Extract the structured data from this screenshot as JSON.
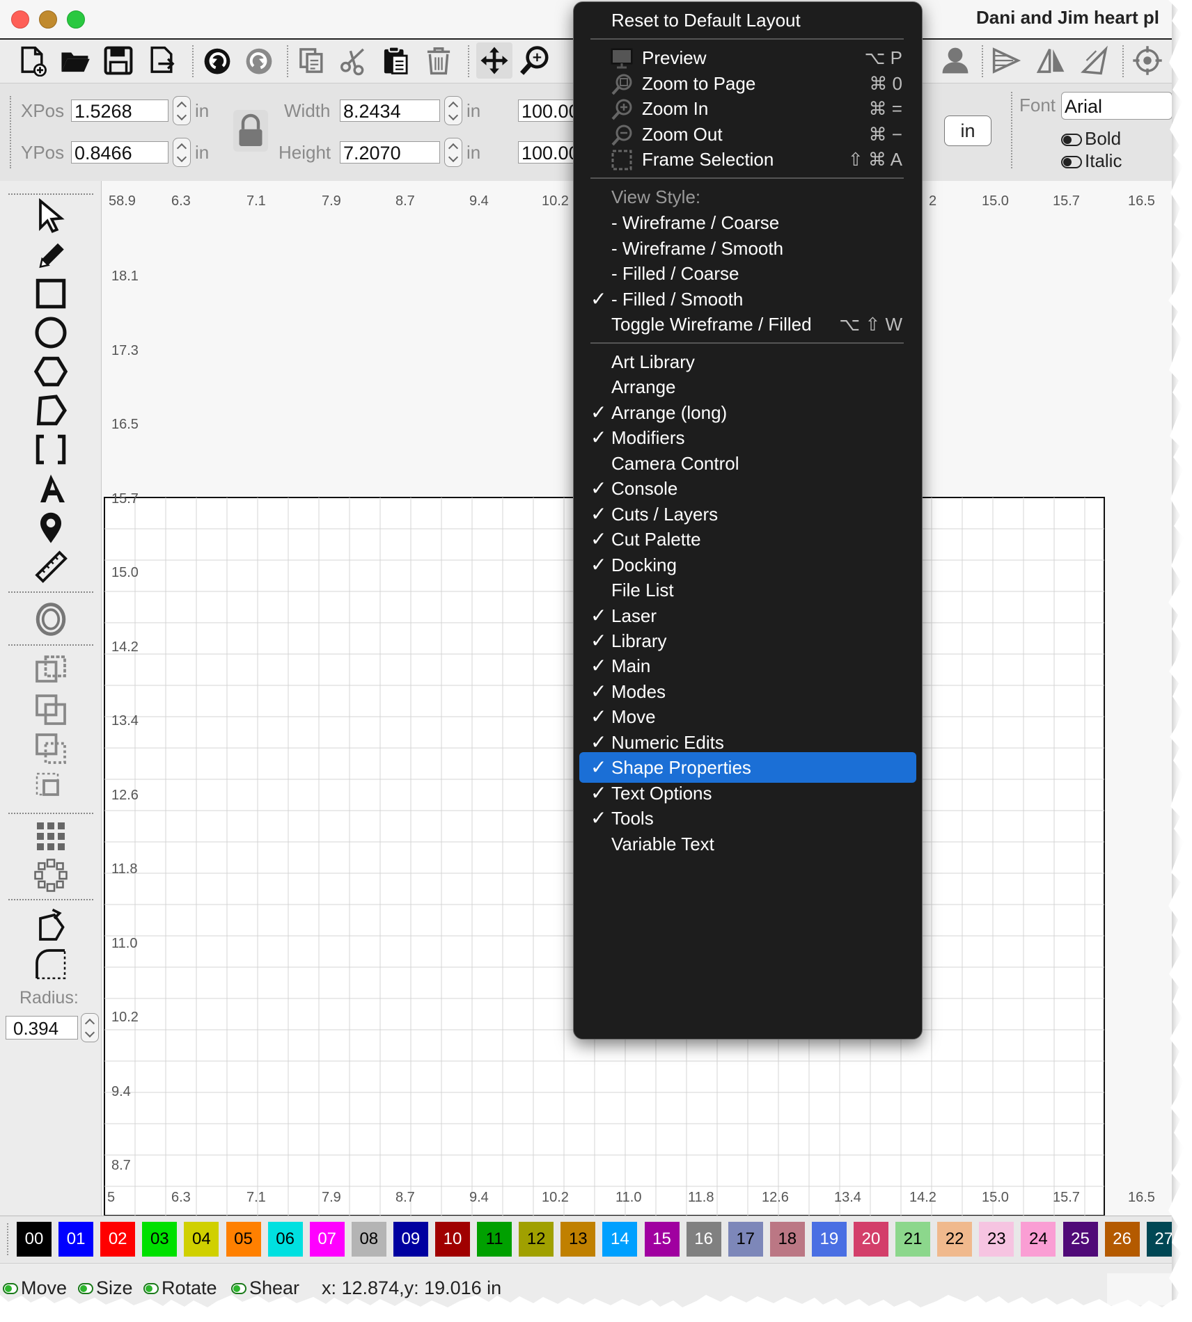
{
  "window": {
    "title": "Dani and Jim heart pl"
  },
  "toolbar": {
    "icons": [
      "new-file-icon",
      "open-folder-icon",
      "save-icon",
      "export-icon",
      "undo-icon",
      "redo-icon",
      "copy-icon",
      "cut-icon",
      "paste-icon",
      "delete-icon",
      "move-icon",
      "zoom-icon",
      "user-icon",
      "mirror-horizontal-icon",
      "mirror-icon",
      "mirror-vertical-icon",
      "target-icon"
    ]
  },
  "numeric": {
    "xpos_label": "XPos",
    "xpos_value": "1.5268",
    "ypos_label": "YPos",
    "ypos_value": "0.8466",
    "width_label": "Width",
    "width_value": "8.2434",
    "height_label": "Height",
    "height_value": "7.2070",
    "unit": "in",
    "pct_w": "100.00",
    "pct_h": "100.00",
    "unit_button": "in",
    "font_label": "Font",
    "font_value": "Arial",
    "bold_label": "Bold",
    "italic_label": "Italic"
  },
  "left_tools": {
    "radius_label": "Radius:",
    "radius_value": "0.394"
  },
  "ruler": {
    "top": [
      "58.9",
      "6.3",
      "7.1",
      "7.9",
      "8.7",
      "9.4",
      "10.2",
      "2",
      "15.0",
      "15.7",
      "16.5"
    ],
    "bottom": [
      "5",
      "6.3",
      "7.1",
      "7.9",
      "8.7",
      "9.4",
      "10.2",
      "11.0",
      "11.8",
      "12.6",
      "13.4",
      "14.2",
      "15.0",
      "15.7",
      "16.5"
    ],
    "left": [
      "18.1",
      "17.3",
      "16.5",
      "15.7",
      "15.0",
      "14.2",
      "13.4",
      "12.6",
      "11.8",
      "11.0",
      "10.2",
      "9.4",
      "8.7"
    ]
  },
  "palette": [
    {
      "label": "00",
      "color": "#000000",
      "text": "#ffffff"
    },
    {
      "label": "01",
      "color": "#0000ff",
      "text": "#ffffff"
    },
    {
      "label": "02",
      "color": "#ff0000",
      "text": "#ffffff"
    },
    {
      "label": "03",
      "color": "#00e000",
      "text": "#000000"
    },
    {
      "label": "04",
      "color": "#d0d000",
      "text": "#000000"
    },
    {
      "label": "05",
      "color": "#ff8000",
      "text": "#000000"
    },
    {
      "label": "06",
      "color": "#00e0e0",
      "text": "#000000"
    },
    {
      "label": "07",
      "color": "#ff00ff",
      "text": "#ffffff"
    },
    {
      "label": "08",
      "color": "#b4b4b4",
      "text": "#000000"
    },
    {
      "label": "09",
      "color": "#0000a0",
      "text": "#ffffff"
    },
    {
      "label": "10",
      "color": "#a00000",
      "text": "#ffffff"
    },
    {
      "label": "11",
      "color": "#00a000",
      "text": "#000000"
    },
    {
      "label": "12",
      "color": "#a0a000",
      "text": "#000000"
    },
    {
      "label": "13",
      "color": "#c08000",
      "text": "#000000"
    },
    {
      "label": "14",
      "color": "#00a0ff",
      "text": "#ffffff"
    },
    {
      "label": "15",
      "color": "#a000a0",
      "text": "#ffffff"
    },
    {
      "label": "16",
      "color": "#808080",
      "text": "#ffffff"
    },
    {
      "label": "17",
      "color": "#7d87b9",
      "text": "#000000"
    },
    {
      "label": "18",
      "color": "#bb7784",
      "text": "#000000"
    },
    {
      "label": "19",
      "color": "#4a6fe3",
      "text": "#ffffff"
    },
    {
      "label": "20",
      "color": "#d33f6a",
      "text": "#ffffff"
    },
    {
      "label": "21",
      "color": "#8cd78c",
      "text": "#000000"
    },
    {
      "label": "22",
      "color": "#f0b98d",
      "text": "#000000"
    },
    {
      "label": "23",
      "color": "#f6c4e1",
      "text": "#000000"
    },
    {
      "label": "24",
      "color": "#fa9ed4",
      "text": "#000000"
    },
    {
      "label": "25",
      "color": "#500a78",
      "text": "#ffffff"
    },
    {
      "label": "26",
      "color": "#b45a00",
      "text": "#ffffff"
    },
    {
      "label": "27",
      "color": "#004754",
      "text": "#ffffff"
    }
  ],
  "status": {
    "move": "Move",
    "size": "Size",
    "rotate": "Rotate",
    "shear": "Shear",
    "coords": "x: 12.874,y: 19.016 in"
  },
  "menu": {
    "reset": "Reset to Default Layout",
    "view_items": [
      {
        "label": "Preview",
        "shortcut": "⌥ P",
        "icon": "monitor-icon"
      },
      {
        "label": "Zoom to Page",
        "shortcut": "⌘ 0",
        "icon": "zoom-page-icon"
      },
      {
        "label": "Zoom In",
        "shortcut": "⌘ =",
        "icon": "zoom-in-icon"
      },
      {
        "label": "Zoom Out",
        "shortcut": "⌘ −",
        "icon": "zoom-out-icon"
      },
      {
        "label": "Frame Selection",
        "shortcut": "⇧ ⌘ A",
        "icon": "frame-selection-icon"
      }
    ],
    "view_style_header": "View Style:",
    "view_styles": [
      {
        "label": "-  Wireframe / Coarse",
        "checked": false
      },
      {
        "label": "-  Wireframe / Smooth",
        "checked": false
      },
      {
        "label": "-  Filled / Coarse",
        "checked": false
      },
      {
        "label": "-  Filled / Smooth",
        "checked": true
      }
    ],
    "toggle": {
      "label": "Toggle Wireframe / Filled",
      "shortcut": "⌥ ⇧ W"
    },
    "panels": [
      {
        "label": "Art Library",
        "checked": false
      },
      {
        "label": "Arrange",
        "checked": false
      },
      {
        "label": "Arrange (long)",
        "checked": true
      },
      {
        "label": "Modifiers",
        "checked": true
      },
      {
        "label": "Camera Control",
        "checked": false
      },
      {
        "label": "Console",
        "checked": true
      },
      {
        "label": "Cuts / Layers",
        "checked": true
      },
      {
        "label": "Cut Palette",
        "checked": true
      },
      {
        "label": "Docking",
        "checked": true
      },
      {
        "label": "File List",
        "checked": false
      },
      {
        "label": "Laser",
        "checked": true
      },
      {
        "label": "Library",
        "checked": true
      },
      {
        "label": "Main",
        "checked": true
      },
      {
        "label": "Modes",
        "checked": true
      },
      {
        "label": "Move",
        "checked": true
      },
      {
        "label": "Numeric Edits",
        "checked": true
      },
      {
        "label": "Shape Properties",
        "checked": true,
        "highlighted": true
      },
      {
        "label": "Text Options",
        "checked": true
      },
      {
        "label": "Tools",
        "checked": true
      },
      {
        "label": "Variable Text",
        "checked": false
      }
    ],
    "check_glyph": "✓",
    "highlight_color": "#1b6fd6"
  }
}
